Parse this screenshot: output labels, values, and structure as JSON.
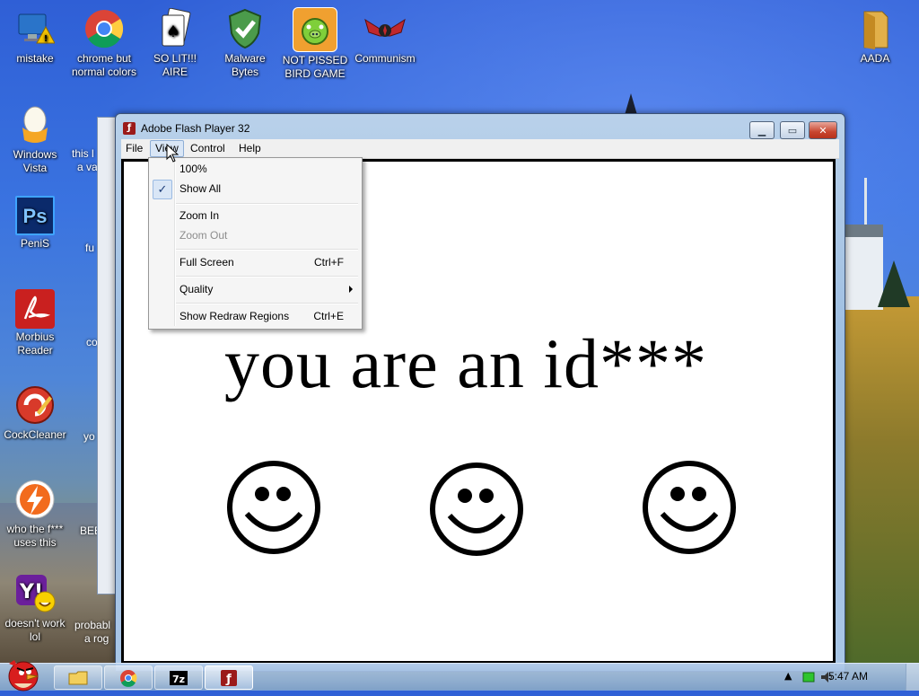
{
  "desktop": {
    "icons": [
      {
        "label": "mistake",
        "icon": "pc-warning-icon",
        "color": "#2a74c9"
      },
      {
        "label": "chrome but normal colors",
        "icon": "chrome-icon",
        "color": "#dd4b39"
      },
      {
        "label": "SO LIT!!! AIRE",
        "icon": "solitaire-icon",
        "color": "#f4f4f4"
      },
      {
        "label": "Malware Bytes",
        "icon": "shield-check-icon",
        "color": "#3a7d3a"
      },
      {
        "label": "NOT PISSED BIRD GAME",
        "icon": "pig-icon",
        "color": "#f0a030"
      },
      {
        "label": "Communism",
        "icon": "emblem-icon",
        "color": "#c0282c"
      },
      {
        "label": "AADA",
        "icon": "folder-icon",
        "color": "#e2b04a"
      },
      {
        "label": "Windows Vista",
        "icon": "egg-icon",
        "color": "#f2efe0"
      },
      {
        "label": "PeniS",
        "icon": "photoshop-icon",
        "color": "#0b2a6b"
      },
      {
        "label": "Morbius Reader",
        "icon": "pdf-icon",
        "color": "#c9201f"
      },
      {
        "label": "CockCleaner",
        "icon": "cleaner-icon",
        "color": "#d83a2a"
      },
      {
        "label": "who the f*** uses this",
        "icon": "lightning-icon",
        "color": "#f26b1d"
      },
      {
        "label": "doesn't work lol",
        "icon": "yahoo-icon",
        "color": "#6b1f9b"
      }
    ],
    "partial_labels": [
      "this l",
      "a va",
      "fu",
      "co",
      "yo",
      "BEE",
      "probabl",
      "a rog"
    ]
  },
  "window": {
    "title": "Adobe Flash Player 32",
    "menu": [
      "File",
      "View",
      "Control",
      "Help"
    ],
    "active_menu": "View",
    "content_text": "you are an id***"
  },
  "view_menu": {
    "items": [
      {
        "label": "100%",
        "shortcut": "",
        "checked": false,
        "disabled": false
      },
      {
        "label": "Show All",
        "shortcut": "",
        "checked": true,
        "disabled": false
      },
      {
        "label": "Zoom In",
        "shortcut": "",
        "checked": false,
        "disabled": false
      },
      {
        "label": "Zoom Out",
        "shortcut": "",
        "checked": false,
        "disabled": true
      },
      {
        "label": "Full Screen",
        "shortcut": "Ctrl+F",
        "checked": false,
        "disabled": false
      },
      {
        "label": "Quality",
        "shortcut": "",
        "checked": false,
        "disabled": false,
        "submenu": true
      },
      {
        "label": "Show Redraw Regions",
        "shortcut": "Ctrl+E",
        "checked": false,
        "disabled": false
      }
    ]
  },
  "taskbar": {
    "clock": "5:47 AM",
    "buttons": [
      "explorer-icon",
      "chrome-icon",
      "7zip-icon",
      "flash-icon"
    ]
  }
}
